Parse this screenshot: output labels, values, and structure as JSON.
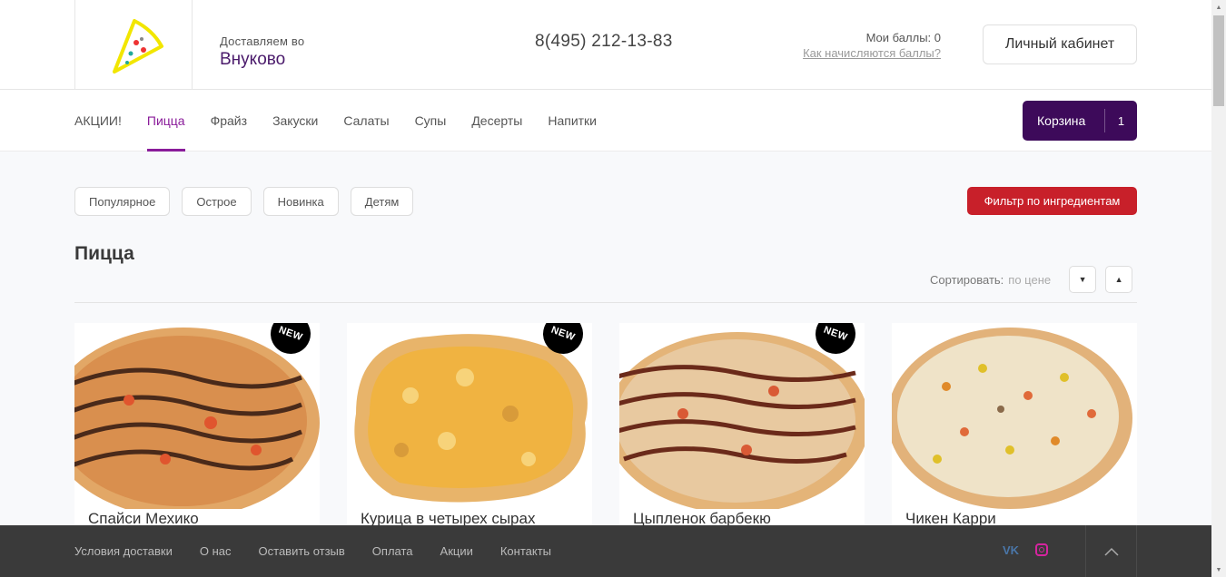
{
  "header": {
    "deliver_label": "Доставляем во",
    "city": "Внуково",
    "phone": "8(495) 212-13-83",
    "points_label": "Мои баллы: 0",
    "points_link": "Как начисляются баллы?",
    "cabinet": "Личный кабинет"
  },
  "nav": {
    "items": [
      "АКЦИИ!",
      "Пицца",
      "Фрайз",
      "Закуски",
      "Салаты",
      "Супы",
      "Десерты",
      "Напитки"
    ],
    "active": "Пицца",
    "cart_label": "Корзина",
    "cart_count": "1"
  },
  "filters": {
    "tags": [
      "Популярное",
      "Острое",
      "Новинка",
      "Детям"
    ],
    "ingredient_filter": "Фильтр по ингредиентам"
  },
  "section": {
    "title": "Пицца",
    "sort_label": "Сортировать:",
    "sort_value": "по цене"
  },
  "products": [
    {
      "name": "Спайси Мехико",
      "badge": "NEW"
    },
    {
      "name": "Курица в четырех сырах",
      "badge": "NEW"
    },
    {
      "name": "Цыпленок барбекю",
      "badge": "NEW"
    },
    {
      "name": "Чикен Карри",
      "badge": ""
    }
  ],
  "footer": {
    "links": [
      "Условия доставки",
      "О нас",
      "Оставить отзыв",
      "Оплата",
      "Акции",
      "Контакты"
    ],
    "vk": "VK"
  },
  "colors": {
    "accent": "#8a1c9a",
    "cart": "#3d0a5a",
    "filter": "#c8202a",
    "footer": "#3a3a3a"
  }
}
